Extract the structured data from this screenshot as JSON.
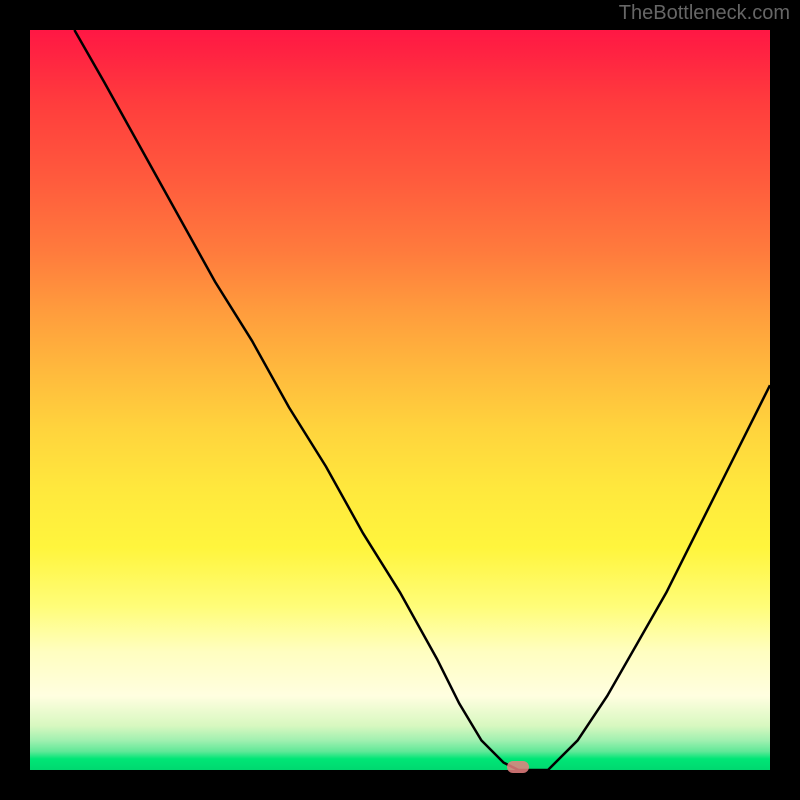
{
  "watermark": "TheBottleneck.com",
  "chart_data": {
    "type": "line",
    "title": "",
    "xlabel": "",
    "ylabel": "",
    "xlim": [
      0,
      100
    ],
    "ylim": [
      0,
      100
    ],
    "series": [
      {
        "name": "curve",
        "x": [
          6,
          10,
          15,
          20,
          25,
          30,
          35,
          40,
          45,
          50,
          55,
          58,
          61,
          64,
          66,
          70,
          74,
          78,
          82,
          86,
          90,
          94,
          98,
          100
        ],
        "values": [
          100,
          93,
          84,
          75,
          66,
          58,
          49,
          41,
          32,
          24,
          15,
          9,
          4,
          1,
          0,
          0,
          4,
          10,
          17,
          24,
          32,
          40,
          48,
          52
        ]
      }
    ],
    "marker": {
      "x": 66,
      "y": 0
    },
    "gradient_stops": [
      {
        "pct": 0,
        "color": "#ff1744"
      },
      {
        "pct": 50,
        "color": "#ffd43d"
      },
      {
        "pct": 90,
        "color": "#fffee0"
      },
      {
        "pct": 100,
        "color": "#00d870"
      }
    ]
  }
}
